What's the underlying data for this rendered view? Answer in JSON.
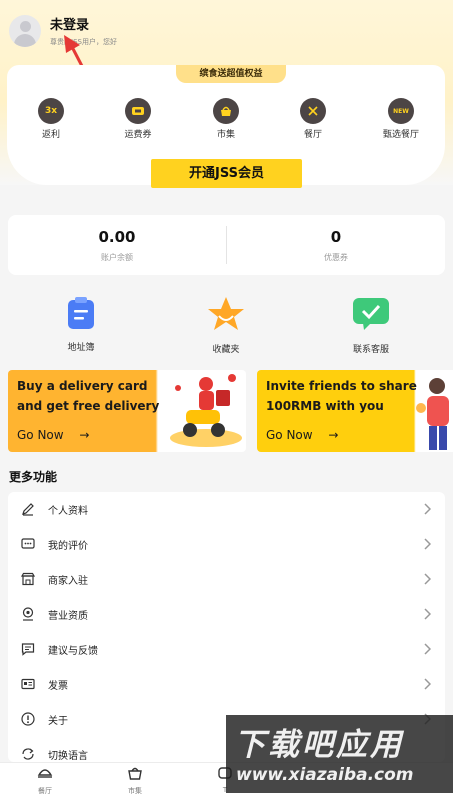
{
  "user": {
    "name": "未登录",
    "subtitle": "尊贵的JSS用户，您好"
  },
  "member": {
    "tab_label": "缤食送超值权益",
    "perks": [
      {
        "label": "返利",
        "icon": "rebate-3x-icon"
      },
      {
        "label": "运费券",
        "icon": "coupon-ticket-icon"
      },
      {
        "label": "市集",
        "icon": "market-basket-icon"
      },
      {
        "label": "餐厅",
        "icon": "restaurant-cutlery-icon"
      },
      {
        "label": "甄选餐厅",
        "icon": "new-badge-icon",
        "badge": "NEW"
      }
    ],
    "rebate_badge": "3x",
    "open_button": "开通JSS会员"
  },
  "balance": {
    "account": {
      "value": "0.00",
      "label": "账户余额"
    },
    "coupons": {
      "value": "0",
      "label": "优惠券"
    }
  },
  "quick": [
    {
      "label": "地址簿",
      "icon": "address-book-icon"
    },
    {
      "label": "收藏夹",
      "icon": "favorites-star-icon"
    },
    {
      "label": "联系客服",
      "icon": "customer-service-chat-icon"
    }
  ],
  "banners": {
    "left": {
      "line1": "Buy a delivery card",
      "line2": "and get free delivery",
      "cta": "Go Now",
      "arrow": "→"
    },
    "right": {
      "line1": "Invite friends to share",
      "line2": "100RMB with you",
      "cta": "Go Now",
      "arrow": "→"
    }
  },
  "more": {
    "title": "更多功能",
    "items": [
      {
        "label": "个人资料",
        "icon": "edit-pencil-icon"
      },
      {
        "label": "我的评价",
        "icon": "comment-icon"
      },
      {
        "label": "商家入驻",
        "icon": "store-icon"
      },
      {
        "label": "营业资质",
        "icon": "certificate-icon"
      },
      {
        "label": "建议与反馈",
        "icon": "feedback-icon"
      },
      {
        "label": "发票",
        "icon": "invoice-icon"
      },
      {
        "label": "关于",
        "icon": "info-icon"
      },
      {
        "label": "切换语言",
        "icon": "language-switch-icon"
      }
    ]
  },
  "tabbar": {
    "items": [
      {
        "label": "餐厅",
        "icon": "restaurant-tab-icon"
      },
      {
        "label": "市集",
        "icon": "market-tab-icon"
      },
      {
        "label": "T",
        "icon": "t-tab-icon"
      }
    ]
  },
  "watermark": {
    "title": "下载吧应用",
    "url": "www.xiazaiba.com"
  },
  "colors": {
    "brand_yellow": "#ffd21f",
    "banner_orange": "#ffb430",
    "banner_yellow": "#ffcf0d",
    "perk_circle": "#4c4545",
    "annotation_arrow": "#e53935"
  }
}
